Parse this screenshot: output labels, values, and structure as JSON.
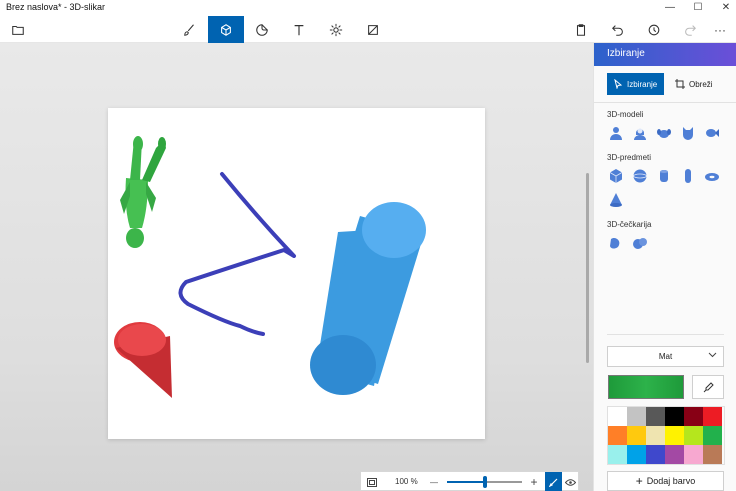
{
  "window": {
    "title": "Brez naslova* - 3D-slikar",
    "minimize": "—",
    "maximize": "☐",
    "close": "✕"
  },
  "toolbar": {
    "icons": [
      "folder-icon",
      "brush-icon",
      "cube-icon",
      "sticker-icon",
      "text-icon",
      "effects-icon",
      "canvas-icon",
      "paste-icon",
      "undo-icon",
      "history-icon",
      "redo-icon",
      "more-icon"
    ],
    "active": "cube-icon",
    "more_label": "···"
  },
  "zoom": {
    "value_label": "100 %",
    "minus": "—",
    "plus": "+",
    "level_fraction": 0.5
  },
  "panel": {
    "title": "Izbiranje",
    "select_label": "Izbiranje",
    "crop_label": "Obreži",
    "section_models": "3D-modeli",
    "section_objects": "3D-predmeti",
    "section_doodles": "3D-čečkarija",
    "material_value": "Mat",
    "add_color_label": "Dodaj barvo",
    "current_color": "#2db24a",
    "palette": [
      "#ffffff",
      "#c3c3c3",
      "#585858",
      "#000000",
      "#880015",
      "#ed1c24",
      "#ff7f27",
      "#ffc90e",
      "#efe4b0",
      "#fff200",
      "#b5e61d",
      "#22b14c",
      "#99f0ec",
      "#00a2e8",
      "#3f48cc",
      "#a349a4",
      "#f7a8d0",
      "#b97a57"
    ]
  },
  "colors": {
    "accent": "#0063b1",
    "icon_blue": "#4f7fd6",
    "figure_green": "#3cb54a",
    "stroke_blue": "#3c3fb8",
    "cylinder_blue": "#3c9be0",
    "cone_red": "#e03a3e"
  }
}
